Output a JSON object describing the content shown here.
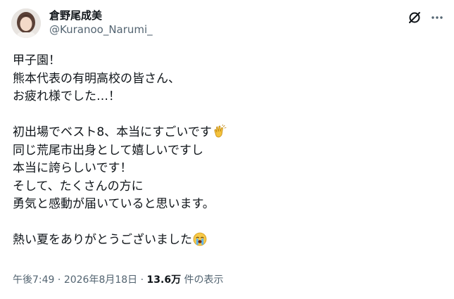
{
  "author": {
    "display_name": "倉野尾成美",
    "handle": "@Kuranoo_Narumi_"
  },
  "header_icons": {
    "grok": "grok-icon",
    "more": "more-icon"
  },
  "tweet": {
    "lines": [
      "甲子園！",
      "熊本代表の有明高校の皆さん、",
      "お疲れ様でした…！",
      "",
      "初出場でベスト8、本当にすごいです",
      "同じ荒尾市出身として嬉しいですし",
      "本当に誇らしいです！",
      "そして、たくさんの方に",
      "勇気と感動が届いていると思います。",
      "",
      "熱い夏をありがとうございました"
    ],
    "emojis": {
      "clap": "clapping-hands-emoji",
      "crying": "loudly-crying-face-emoji"
    }
  },
  "meta": {
    "time": "午後7:49",
    "separator": "·",
    "date": "2026年8月18日",
    "views_count": "13.6万",
    "views_label": "件の表示"
  }
}
